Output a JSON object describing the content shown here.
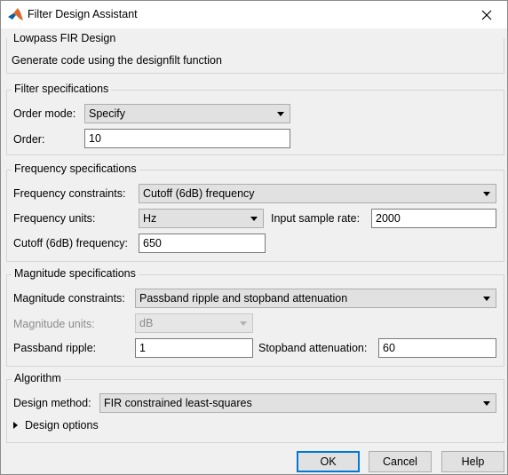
{
  "window": {
    "title": "Filter Design Assistant"
  },
  "header": {
    "group_title": "Lowpass FIR Design",
    "description": "Generate code using the designfilt function"
  },
  "filter_specs": {
    "group_title": "Filter specifications",
    "order_mode_label": "Order mode:",
    "order_mode_value": "Specify",
    "order_label": "Order:",
    "order_value": "10"
  },
  "frequency_specs": {
    "group_title": "Frequency specifications",
    "constraints_label": "Frequency constraints:",
    "constraints_value": "Cutoff (6dB) frequency",
    "units_label": "Frequency units:",
    "units_value": "Hz",
    "sample_rate_label": "Input sample rate:",
    "sample_rate_value": "2000",
    "cutoff_label": "Cutoff (6dB) frequency:",
    "cutoff_value": "650"
  },
  "magnitude_specs": {
    "group_title": "Magnitude specifications",
    "constraints_label": "Magnitude constraints:",
    "constraints_value": "Passband ripple and stopband attenuation",
    "units_label": "Magnitude units:",
    "units_value": "dB",
    "passband_label": "Passband ripple:",
    "passband_value": "1",
    "stopband_label": "Stopband attenuation:",
    "stopband_value": "60"
  },
  "algorithm": {
    "group_title": "Algorithm",
    "method_label": "Design method:",
    "method_value": "FIR constrained least-squares",
    "design_options_label": "Design options"
  },
  "buttons": {
    "ok": "OK",
    "cancel": "Cancel",
    "help": "Help"
  },
  "colors": {
    "window_bg": "#f0f0f0",
    "accent_border": "#0078d7",
    "disabled_text": "#8c8c8c"
  },
  "icons": {
    "app": "matlab-logo-icon",
    "close": "close-icon",
    "expander": "triangle-right-icon",
    "dropdown": "chevron-down-icon"
  }
}
